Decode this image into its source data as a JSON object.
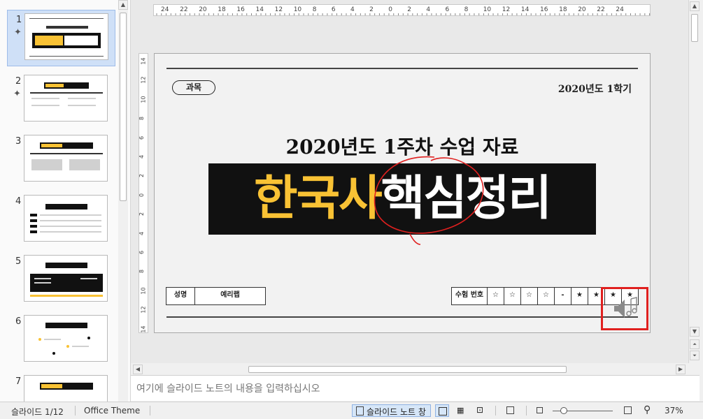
{
  "thumbnails": [
    {
      "num": "1",
      "has_anim": true,
      "selected": true
    },
    {
      "num": "2",
      "has_anim": true,
      "selected": false
    },
    {
      "num": "3",
      "has_anim": false,
      "selected": false
    },
    {
      "num": "4",
      "has_anim": false,
      "selected": false
    },
    {
      "num": "5",
      "has_anim": false,
      "selected": false
    },
    {
      "num": "6",
      "has_anim": false,
      "selected": false
    },
    {
      "num": "7",
      "has_anim": false,
      "selected": false
    }
  ],
  "ruler": {
    "horizontal": [
      "24",
      "22",
      "20",
      "18",
      "16",
      "14",
      "12",
      "10",
      "8",
      "6",
      "4",
      "2",
      "0",
      "2",
      "4",
      "6",
      "8",
      "10",
      "12",
      "14",
      "16",
      "18",
      "20",
      "22",
      "24"
    ],
    "vertical": [
      "14",
      "12",
      "10",
      "8",
      "6",
      "4",
      "2",
      "0",
      "2",
      "4",
      "6",
      "8",
      "10",
      "12",
      "14"
    ]
  },
  "slide": {
    "subject_label": "과목",
    "semester": "2020년도 1학기",
    "headline": "2020년도 1주차 수업 자료",
    "banner": {
      "part_yellow": "한국사",
      "part_white": "핵심정리"
    },
    "name_label": "성명",
    "name_value": "예리랩",
    "exam_label": "수험 번호",
    "exam_marks": [
      "☆",
      "☆",
      "☆",
      "☆",
      "-",
      "★",
      "★",
      "★",
      "★"
    ],
    "audio_icon": "speaker-music-icon",
    "annotation_color": "#e0201f"
  },
  "notes": {
    "placeholder": "여기에 슬라이드 노트의 내용을 입력하십시오"
  },
  "status": {
    "slide_indicator": "슬라이드 1/12",
    "theme": "Office Theme",
    "notes_button": "슬라이드 노트 창",
    "zoom": "37%"
  },
  "colors": {
    "accent_yellow": "#f9c234",
    "banner_black": "#111111",
    "selection": "#cfe0f7"
  }
}
